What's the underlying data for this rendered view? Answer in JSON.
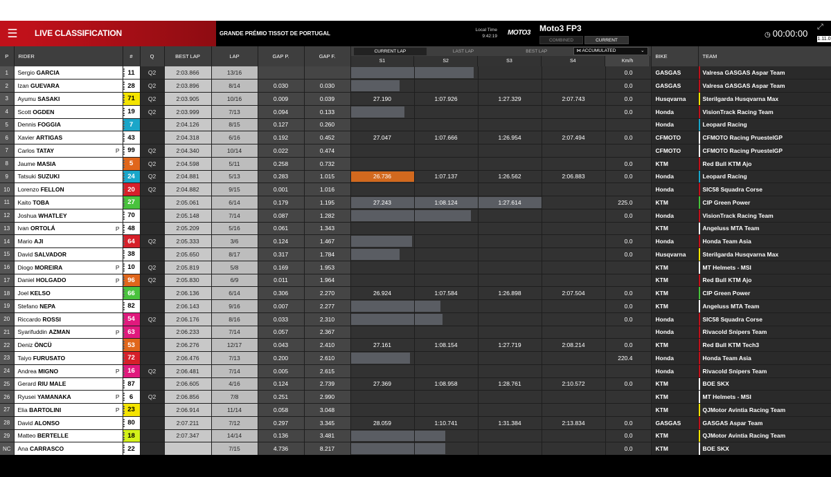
{
  "app": {
    "title": "LIVE CLASSIFICATION",
    "event": "GRANDE PRÉMIO TISSOT DE PORTUGAL",
    "local_time_label": "Local Time",
    "local_time": "9:42:19",
    "logo": "MOTO3",
    "session": "Moto3 FP3",
    "modes": [
      "COMBINED",
      "CURRENT"
    ],
    "timer": "00:00:00",
    "version": "1.11.0"
  },
  "columns": {
    "p": "P",
    "rider": "RIDER",
    "num": "#",
    "q": "Q",
    "best_lap": "BEST LAP",
    "lap": "LAP",
    "gap_p": "GAP P.",
    "gap_f": "GAP F.",
    "bike": "BIKE",
    "team": "TEAM",
    "tabs": [
      "CURRENT LAP",
      "LAST LAP",
      "BEST LAP"
    ],
    "accumulated": "ACCUMULATED",
    "sectors": [
      "S1",
      "S2",
      "S3",
      "S4",
      "Km/h"
    ]
  },
  "colors": {
    "accent": "#c0111a",
    "highlight": "#d2691e"
  },
  "rows": [
    {
      "p": "1",
      "first": "Sergio",
      "last": "GARCIA",
      "pen": "",
      "num": "11",
      "numBg": "#ffffff",
      "numFg": "#000000",
      "q": "Q2",
      "best": "2:03.866",
      "lap": "13/16",
      "gp": "",
      "gf": "",
      "s1": "",
      "s2": "",
      "s3": "",
      "s4": "",
      "kmh": "0.0",
      "bike": "GASGAS",
      "team": "Valresa GASGAS Aspar Team",
      "stripe": "#c0111a",
      "progress": 0.48,
      "highlight": false
    },
    {
      "p": "2",
      "first": "Izan",
      "last": "GUEVARA",
      "pen": "",
      "num": "28",
      "numBg": "#ffffff",
      "numFg": "#000000",
      "q": "Q2",
      "best": "2:03.896",
      "lap": "8/14",
      "gp": "0.030",
      "gf": "0.030",
      "s1": "",
      "s2": "",
      "s3": "",
      "s4": "",
      "kmh": "0.0",
      "bike": "GASGAS",
      "team": "Valresa GASGAS Aspar Team",
      "stripe": "#c0111a",
      "progress": 0.19,
      "highlight": false
    },
    {
      "p": "3",
      "first": "Ayumu",
      "last": "SASAKI",
      "pen": "",
      "num": "71",
      "numBg": "#f4e400",
      "numFg": "#000000",
      "q": "Q2",
      "best": "2:03.905",
      "lap": "10/16",
      "gp": "0.009",
      "gf": "0.039",
      "s1": "27.190",
      "s2": "1:07.926",
      "s3": "1:27.329",
      "s4": "2:07.743",
      "kmh": "0.0",
      "bike": "Husqvarna",
      "team": "Sterilgarda Husqvarna Max",
      "stripe": "#f4e400",
      "progress": 0,
      "highlight": false
    },
    {
      "p": "4",
      "first": "Scott",
      "last": "OGDEN",
      "pen": "",
      "num": "19",
      "numBg": "#ffffff",
      "numFg": "#000000",
      "q": "Q2",
      "best": "2:03.999",
      "lap": "7/13",
      "gp": "0.094",
      "gf": "0.133",
      "s1": "",
      "s2": "",
      "s3": "",
      "s4": "",
      "kmh": "0.0",
      "bike": "Honda",
      "team": "VisionTrack Racing Team",
      "stripe": "#c0111a",
      "progress": 0.21,
      "highlight": false
    },
    {
      "p": "5",
      "first": "Dennis",
      "last": "FOGGIA",
      "pen": "",
      "num": "7",
      "numBg": "#1aa6c9",
      "numFg": "#ffffff",
      "q": "",
      "best": "2:04.126",
      "lap": "8/15",
      "gp": "0.127",
      "gf": "0.260",
      "s1": "",
      "s2": "",
      "s3": "",
      "s4": "",
      "kmh": "",
      "bike": "Honda",
      "team": "Leopard Racing",
      "stripe": "#1aa6c9",
      "progress": 0,
      "highlight": false
    },
    {
      "p": "6",
      "first": "Xavier",
      "last": "ARTIGAS",
      "pen": "",
      "num": "43",
      "numBg": "#ffffff",
      "numFg": "#000000",
      "q": "",
      "best": "2:04.318",
      "lap": "6/16",
      "gp": "0.192",
      "gf": "0.452",
      "s1": "27.047",
      "s2": "1:07.666",
      "s3": "1:26.954",
      "s4": "2:07.494",
      "kmh": "0.0",
      "bike": "CFMOTO",
      "team": "CFMOTO Racing PruestelGP",
      "stripe": "#ffffff",
      "progress": 0,
      "highlight": false
    },
    {
      "p": "7",
      "first": "Carlos",
      "last": "TATAY",
      "pen": "P",
      "num": "99",
      "numBg": "#ffffff",
      "numFg": "#000000",
      "q": "Q2",
      "best": "2:04.340",
      "lap": "10/14",
      "gp": "0.022",
      "gf": "0.474",
      "s1": "",
      "s2": "",
      "s3": "",
      "s4": "",
      "kmh": "",
      "bike": "CFMOTO",
      "team": "CFMOTO Racing PruestelGP",
      "stripe": "#ffffff",
      "progress": 0,
      "highlight": false
    },
    {
      "p": "8",
      "first": "Jaume",
      "last": "MASIA",
      "pen": "",
      "num": "5",
      "numBg": "#e0661b",
      "numFg": "#ffffff",
      "q": "Q2",
      "best": "2:04.598",
      "lap": "5/11",
      "gp": "0.258",
      "gf": "0.732",
      "s1": "",
      "s2": "",
      "s3": "",
      "s4": "",
      "kmh": "0.0",
      "bike": "KTM",
      "team": "Red Bull KTM Ajo",
      "stripe": "#c0111a",
      "progress": 0,
      "highlight": false
    },
    {
      "p": "9",
      "first": "Tatsuki",
      "last": "SUZUKI",
      "pen": "",
      "num": "24",
      "numBg": "#1aa6c9",
      "numFg": "#ffffff",
      "q": "Q2",
      "best": "2:04.881",
      "lap": "5/13",
      "gp": "0.283",
      "gf": "1.015",
      "s1": "26.736",
      "s2": "1:07.137",
      "s3": "1:26.562",
      "s4": "2:06.883",
      "kmh": "0.0",
      "bike": "Honda",
      "team": "Leopard Racing",
      "stripe": "#1aa6c9",
      "progress": 0,
      "highlight": true
    },
    {
      "p": "10",
      "first": "Lorenzo",
      "last": "FELLON",
      "pen": "",
      "num": "20",
      "numBg": "#d6202a",
      "numFg": "#ffffff",
      "q": "Q2",
      "best": "2:04.882",
      "lap": "9/15",
      "gp": "0.001",
      "gf": "1.016",
      "s1": "",
      "s2": "",
      "s3": "",
      "s4": "",
      "kmh": "",
      "bike": "Honda",
      "team": "SIC58 Squadra Corse",
      "stripe": "#c0111a",
      "progress": 0,
      "highlight": false
    },
    {
      "p": "11",
      "first": "Kaito",
      "last": "TOBA",
      "pen": "",
      "num": "27",
      "numBg": "#49c23d",
      "numFg": "#ffffff",
      "q": "",
      "best": "2:05.061",
      "lap": "6/14",
      "gp": "0.179",
      "gf": "1.195",
      "s1": "27.243",
      "s2": "1:08.124",
      "s3": "1:27.614",
      "s4": "",
      "kmh": "225.0",
      "bike": "KTM",
      "team": "CIP Green Power",
      "stripe": "#49c23d",
      "progress": 0.75,
      "highlight": false
    },
    {
      "p": "12",
      "first": "Joshua",
      "last": "WHATLEY",
      "pen": "",
      "num": "70",
      "numBg": "#ffffff",
      "numFg": "#000000",
      "q": "",
      "best": "2:05.148",
      "lap": "7/14",
      "gp": "0.087",
      "gf": "1.282",
      "s1": "",
      "s2": "",
      "s3": "",
      "s4": "",
      "kmh": "0.0",
      "bike": "Honda",
      "team": "VisionTrack Racing Team",
      "stripe": "#c0111a",
      "progress": 0.47,
      "highlight": false
    },
    {
      "p": "13",
      "first": "Ivan",
      "last": "ORTOLÁ",
      "pen": "P",
      "num": "48",
      "numBg": "#ffffff",
      "numFg": "#000000",
      "q": "",
      "best": "2:05.209",
      "lap": "5/16",
      "gp": "0.061",
      "gf": "1.343",
      "s1": "",
      "s2": "",
      "s3": "",
      "s4": "",
      "kmh": "",
      "bike": "KTM",
      "team": "Angeluss MTA Team",
      "stripe": "#ffffff",
      "progress": 0,
      "highlight": false
    },
    {
      "p": "14",
      "first": "Mario",
      "last": "AJI",
      "pen": "",
      "num": "64",
      "numBg": "#d6202a",
      "numFg": "#ffffff",
      "q": "Q2",
      "best": "2:05.333",
      "lap": "3/6",
      "gp": "0.124",
      "gf": "1.467",
      "s1": "",
      "s2": "",
      "s3": "",
      "s4": "",
      "kmh": "0.0",
      "bike": "Honda",
      "team": "Honda Team Asia",
      "stripe": "#c0111a",
      "progress": 0.24,
      "highlight": false
    },
    {
      "p": "15",
      "first": "David",
      "last": "SALVADOR",
      "pen": "",
      "num": "38",
      "numBg": "#ffffff",
      "numFg": "#000000",
      "q": "",
      "best": "2:05.650",
      "lap": "8/17",
      "gp": "0.317",
      "gf": "1.784",
      "s1": "",
      "s2": "",
      "s3": "",
      "s4": "",
      "kmh": "0.0",
      "bike": "Husqvarna",
      "team": "Sterilgarda Husqvarna Max",
      "stripe": "#f4e400",
      "progress": 0.19,
      "highlight": false
    },
    {
      "p": "16",
      "first": "Diogo",
      "last": "MOREIRA",
      "pen": "P",
      "num": "10",
      "numBg": "#ffffff",
      "numFg": "#000000",
      "q": "Q2",
      "best": "2:05.819",
      "lap": "5/8",
      "gp": "0.169",
      "gf": "1.953",
      "s1": "",
      "s2": "",
      "s3": "",
      "s4": "",
      "kmh": "",
      "bike": "KTM",
      "team": "MT Helmets - MSI",
      "stripe": "#ffffff",
      "progress": 0,
      "highlight": false
    },
    {
      "p": "17",
      "first": "Daniel",
      "last": "HOLGADO",
      "pen": "P",
      "num": "96",
      "numBg": "#e0661b",
      "numFg": "#ffffff",
      "q": "Q2",
      "best": "2:05.830",
      "lap": "6/9",
      "gp": "0.011",
      "gf": "1.964",
      "s1": "",
      "s2": "",
      "s3": "",
      "s4": "",
      "kmh": "",
      "bike": "KTM",
      "team": "Red Bull KTM Ajo",
      "stripe": "#c0111a",
      "progress": 0,
      "highlight": false
    },
    {
      "p": "18",
      "first": "Joel",
      "last": "KELSO",
      "pen": "",
      "num": "66",
      "numBg": "#49c23d",
      "numFg": "#ffffff",
      "q": "",
      "best": "2:06.136",
      "lap": "6/14",
      "gp": "0.306",
      "gf": "2.270",
      "s1": "26.924",
      "s2": "1:07.584",
      "s3": "1:26.898",
      "s4": "2:07.504",
      "kmh": "0.0",
      "bike": "KTM",
      "team": "CIP Green Power",
      "stripe": "#49c23d",
      "progress": 0,
      "highlight": false
    },
    {
      "p": "19",
      "first": "Stefano",
      "last": "NEPA",
      "pen": "",
      "num": "82",
      "numBg": "#ffffff",
      "numFg": "#000000",
      "q": "",
      "best": "2:06.143",
      "lap": "9/16",
      "gp": "0.007",
      "gf": "2.277",
      "s1": "",
      "s2": "",
      "s3": "",
      "s4": "",
      "kmh": "0.0",
      "bike": "KTM",
      "team": "Angeluss MTA Team",
      "stripe": "#ffffff",
      "progress": 0.35,
      "highlight": false
    },
    {
      "p": "20",
      "first": "Riccardo",
      "last": "ROSSI",
      "pen": "",
      "num": "54",
      "numBg": "#e0197d",
      "numFg": "#ffffff",
      "q": "Q2",
      "best": "2:06.176",
      "lap": "8/16",
      "gp": "0.033",
      "gf": "2.310",
      "s1": "",
      "s2": "",
      "s3": "",
      "s4": "",
      "kmh": "0.0",
      "bike": "Honda",
      "team": "SIC58 Squadra Corse",
      "stripe": "#c0111a",
      "progress": 0.36,
      "highlight": false
    },
    {
      "p": "21",
      "first": "Syarifuddin",
      "last": "AZMAN",
      "pen": "P",
      "num": "63",
      "numBg": "#e0197d",
      "numFg": "#ffffff",
      "q": "",
      "best": "2:06.233",
      "lap": "7/14",
      "gp": "0.057",
      "gf": "2.367",
      "s1": "",
      "s2": "",
      "s3": "",
      "s4": "",
      "kmh": "",
      "bike": "Honda",
      "team": "Rivacold Snipers Team",
      "stripe": "#c0111a",
      "progress": 0,
      "highlight": false
    },
    {
      "p": "22",
      "first": "Deniz",
      "last": "ÖNCÜ",
      "pen": "",
      "num": "53",
      "numBg": "#e0661b",
      "numFg": "#ffffff",
      "q": "",
      "best": "2:06.276",
      "lap": "12/17",
      "gp": "0.043",
      "gf": "2.410",
      "s1": "27.161",
      "s2": "1:08.154",
      "s3": "1:27.719",
      "s4": "2:08.214",
      "kmh": "0.0",
      "bike": "KTM",
      "team": "Red Bull KTM Tech3",
      "stripe": "#c0111a",
      "progress": 0,
      "highlight": false
    },
    {
      "p": "23",
      "first": "Taiyo",
      "last": "FURUSATO",
      "pen": "",
      "num": "72",
      "numBg": "#d6202a",
      "numFg": "#ffffff",
      "q": "",
      "best": "2:06.476",
      "lap": "7/13",
      "gp": "0.200",
      "gf": "2.610",
      "s1": "",
      "s2": "",
      "s3": "",
      "s4": "",
      "kmh": "220.4",
      "bike": "Honda",
      "team": "Honda Team Asia",
      "stripe": "#c0111a",
      "progress": 0.23,
      "highlight": false
    },
    {
      "p": "24",
      "first": "Andrea",
      "last": "MIGNO",
      "pen": "P",
      "num": "16",
      "numBg": "#e0197d",
      "numFg": "#ffffff",
      "q": "Q2",
      "best": "2:06.481",
      "lap": "7/14",
      "gp": "0.005",
      "gf": "2.615",
      "s1": "",
      "s2": "",
      "s3": "",
      "s4": "",
      "kmh": "",
      "bike": "Honda",
      "team": "Rivacold Snipers Team",
      "stripe": "#c0111a",
      "progress": 0,
      "highlight": false
    },
    {
      "p": "25",
      "first": "Gerard",
      "last": "RIU MALE",
      "pen": "",
      "num": "87",
      "numBg": "#ffffff",
      "numFg": "#000000",
      "q": "",
      "best": "2:06.605",
      "lap": "4/16",
      "gp": "0.124",
      "gf": "2.739",
      "s1": "27.369",
      "s2": "1:08.958",
      "s3": "1:28.761",
      "s4": "2:10.572",
      "kmh": "0.0",
      "bike": "KTM",
      "team": "BOE SKX",
      "stripe": "#ffffff",
      "progress": 0,
      "highlight": false
    },
    {
      "p": "26",
      "first": "Ryusei",
      "last": "YAMANAKA",
      "pen": "P",
      "num": "6",
      "numBg": "#ffffff",
      "numFg": "#000000",
      "q": "Q2",
      "best": "2:06.856",
      "lap": "7/8",
      "gp": "0.251",
      "gf": "2.990",
      "s1": "",
      "s2": "",
      "s3": "",
      "s4": "",
      "kmh": "",
      "bike": "KTM",
      "team": "MT Helmets - MSI",
      "stripe": "#ffffff",
      "progress": 0,
      "highlight": false
    },
    {
      "p": "27",
      "first": "Elia",
      "last": "BARTOLINI",
      "pen": "P",
      "num": "23",
      "numBg": "#f4e400",
      "numFg": "#000000",
      "q": "",
      "best": "2:06.914",
      "lap": "11/14",
      "gp": "0.058",
      "gf": "3.048",
      "s1": "",
      "s2": "",
      "s3": "",
      "s4": "",
      "kmh": "",
      "bike": "KTM",
      "team": "QJMotor Avintia Racing Team",
      "stripe": "#f4e400",
      "progress": 0,
      "highlight": false
    },
    {
      "p": "28",
      "first": "David",
      "last": "ALONSO",
      "pen": "",
      "num": "80",
      "numBg": "#ffffff",
      "numFg": "#000000",
      "q": "",
      "best": "2:07.211",
      "lap": "7/12",
      "gp": "0.297",
      "gf": "3.345",
      "s1": "28.059",
      "s2": "1:10.741",
      "s3": "1:31.384",
      "s4": "2:13.834",
      "kmh": "0.0",
      "bike": "GASGAS",
      "team": "GASGAS Aspar Team",
      "stripe": "#c0111a",
      "progress": 0,
      "highlight": false
    },
    {
      "p": "29",
      "first": "Matteo",
      "last": "BERTELLE",
      "pen": "",
      "num": "18",
      "numBg": "#d4f21a",
      "numFg": "#000000",
      "q": "",
      "best": "2:07.347",
      "lap": "14/14",
      "gp": "0.136",
      "gf": "3.481",
      "s1": "",
      "s2": "",
      "s3": "",
      "s4": "",
      "kmh": "0.0",
      "bike": "KTM",
      "team": "QJMotor Avintia Racing Team",
      "stripe": "#f4e400",
      "progress": 0.37,
      "highlight": false
    },
    {
      "p": "NC",
      "first": "Ana",
      "last": "CARRASCO",
      "pen": "",
      "num": "22",
      "numBg": "#ffffff",
      "numFg": "#000000",
      "q": "",
      "best": "",
      "lap": "7/15",
      "gp": "4.736",
      "gf": "8.217",
      "s1": "",
      "s2": "",
      "s3": "",
      "s4": "",
      "kmh": "0.0",
      "bike": "KTM",
      "team": "BOE SKX",
      "stripe": "#ffffff",
      "progress": 0.37,
      "highlight": false
    }
  ]
}
